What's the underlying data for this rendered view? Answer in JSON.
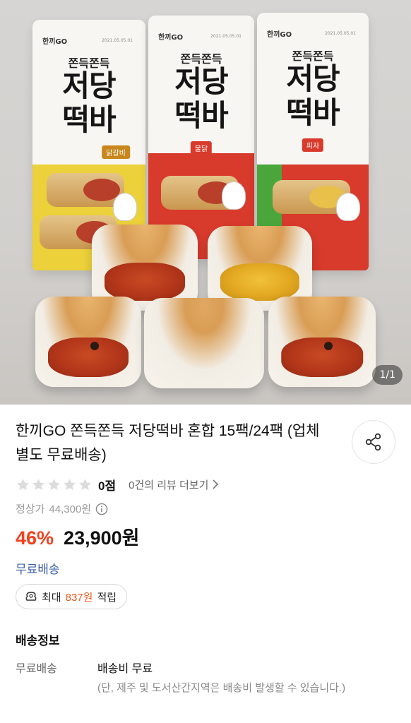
{
  "hero": {
    "image_counter": "1/1",
    "packages": [
      {
        "brand": "한끼GO",
        "date": "2021.05.05.01",
        "tag": "쫀득쫀득",
        "name_line1": "저당",
        "name_line2": "떡바",
        "flavor": "닭갈비",
        "flavor_color": "#e9d033"
      },
      {
        "brand": "한끼GO",
        "date": "2021.05.05.01",
        "tag": "쫀득쫀득",
        "name_line1": "저당",
        "name_line2": "떡바",
        "flavor": "불닭",
        "flavor_color": "#d83a2c"
      },
      {
        "brand": "한끼GO",
        "date": "2021.05.05.01",
        "tag": "쫀득쫀득",
        "name_line1": "저당",
        "name_line2": "떡바",
        "flavor": "피자",
        "flavor_color": "#d83a2c"
      }
    ]
  },
  "product": {
    "title": "한끼GO 쫀득쫀득 저당떡바 혼합 15팩/24팩 (업체별도 무료배송)",
    "rating": {
      "score": "0점",
      "star_count": 5,
      "reviews_link": "0건의 리뷰 더보기"
    },
    "list_price_label": "정상가",
    "list_price": "44,300원",
    "discount": "46%",
    "sale_price": "23,900원",
    "free_shipping": "무료배송",
    "points": {
      "prefix": "최대",
      "amount": "837원",
      "suffix": "적립"
    }
  },
  "shipping": {
    "heading": "배송정보",
    "label": "무료배송",
    "fee": "배송비 무료",
    "note": "(단, 제주 및 도서산간지역은 배송비 발생할 수 있습니다.)"
  },
  "colors": {
    "discount": "#f2411f",
    "free_shipping": "#3d5fa8",
    "points_amount": "#e5591f",
    "star_empty": "#dcdcdc"
  },
  "icons": [
    "share-icon",
    "star-icon",
    "info-icon",
    "chevron-right-icon",
    "coin-bag-icon"
  ]
}
